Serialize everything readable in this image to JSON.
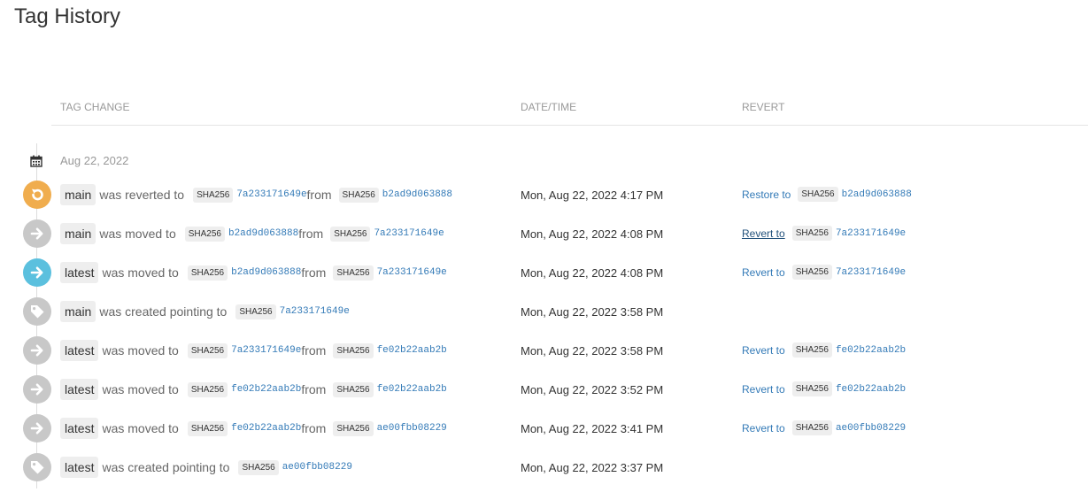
{
  "page": {
    "title": "Tag History"
  },
  "columns": {
    "tag_change": "TAG CHANGE",
    "datetime": "DATE/TIME",
    "revert": "REVERT"
  },
  "colors": {
    "revert": "#f0ad4e",
    "move": "#c8c8c8",
    "move_latest": "#5bc0de",
    "create": "#c8c8c8"
  },
  "group": {
    "date": "Aug 22, 2022",
    "icon": "calendar-icon"
  },
  "entries": [
    {
      "tag": "main",
      "action": "was reverted to",
      "icon": "undo-icon",
      "kind": "revert",
      "to_algo": "SHA256",
      "to_hash": "7a233171649e",
      "from_label": "from",
      "from_algo": "SHA256",
      "from_hash": "b2ad9d063888",
      "datetime": "Mon, Aug 22, 2022 4:17 PM",
      "revert_label": "Restore to",
      "revert_algo": "SHA256",
      "revert_hash": "b2ad9d063888"
    },
    {
      "tag": "main",
      "action": "was moved to",
      "icon": "arrow-right-icon",
      "kind": "move",
      "to_algo": "SHA256",
      "to_hash": "b2ad9d063888",
      "from_label": "from",
      "from_algo": "SHA256",
      "from_hash": "7a233171649e",
      "datetime": "Mon, Aug 22, 2022 4:08 PM",
      "revert_label": "Revert to",
      "revert_algo": "SHA256",
      "revert_hash": "7a233171649e",
      "hovered": true
    },
    {
      "tag": "latest",
      "action": "was moved to",
      "icon": "arrow-right-icon",
      "kind": "move_latest",
      "to_algo": "SHA256",
      "to_hash": "b2ad9d063888",
      "from_label": "from",
      "from_algo": "SHA256",
      "from_hash": "7a233171649e",
      "datetime": "Mon, Aug 22, 2022 4:08 PM",
      "revert_label": "Revert to",
      "revert_algo": "SHA256",
      "revert_hash": "7a233171649e"
    },
    {
      "tag": "main",
      "action": "was created pointing to",
      "icon": "tag-icon",
      "kind": "create",
      "to_algo": "SHA256",
      "to_hash": "7a233171649e",
      "datetime": "Mon, Aug 22, 2022 3:58 PM"
    },
    {
      "tag": "latest",
      "action": "was moved to",
      "icon": "arrow-right-icon",
      "kind": "move",
      "to_algo": "SHA256",
      "to_hash": "7a233171649e",
      "from_label": "from",
      "from_algo": "SHA256",
      "from_hash": "fe02b22aab2b",
      "datetime": "Mon, Aug 22, 2022 3:58 PM",
      "revert_label": "Revert to",
      "revert_algo": "SHA256",
      "revert_hash": "fe02b22aab2b"
    },
    {
      "tag": "latest",
      "action": "was moved to",
      "icon": "arrow-right-icon",
      "kind": "move",
      "to_algo": "SHA256",
      "to_hash": "fe02b22aab2b",
      "from_label": "from",
      "from_algo": "SHA256",
      "from_hash": "fe02b22aab2b",
      "datetime": "Mon, Aug 22, 2022 3:52 PM",
      "revert_label": "Revert to",
      "revert_algo": "SHA256",
      "revert_hash": "fe02b22aab2b"
    },
    {
      "tag": "latest",
      "action": "was moved to",
      "icon": "arrow-right-icon",
      "kind": "move",
      "to_algo": "SHA256",
      "to_hash": "fe02b22aab2b",
      "from_label": "from",
      "from_algo": "SHA256",
      "from_hash": "ae00fbb08229",
      "datetime": "Mon, Aug 22, 2022 3:41 PM",
      "revert_label": "Revert to",
      "revert_algo": "SHA256",
      "revert_hash": "ae00fbb08229"
    },
    {
      "tag": "latest",
      "action": "was created pointing to",
      "icon": "tag-icon",
      "kind": "create",
      "to_algo": "SHA256",
      "to_hash": "ae00fbb08229",
      "datetime": "Mon, Aug 22, 2022 3:37 PM"
    }
  ]
}
